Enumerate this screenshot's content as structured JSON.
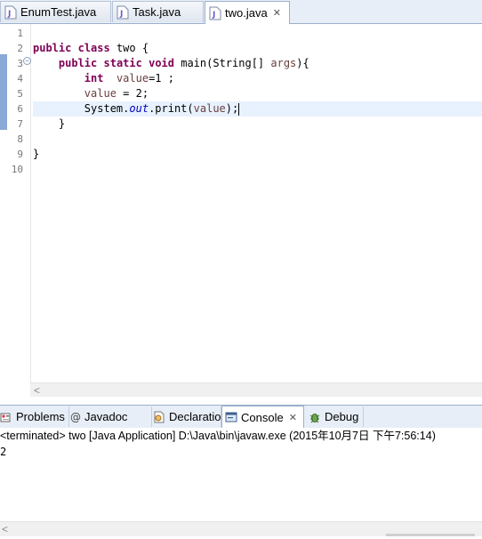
{
  "editor_tabs": [
    {
      "label": "EnumTest.java",
      "active": false
    },
    {
      "label": "Task.java",
      "active": false
    },
    {
      "label": "two.java",
      "active": true,
      "close_icon": "close-icon"
    }
  ],
  "code": {
    "line_numbers": [
      "1",
      "2",
      "3",
      "4",
      "5",
      "6",
      "7",
      "8",
      "9",
      "10"
    ],
    "current_line": 6,
    "lines": [
      [],
      [
        {
          "t": "public",
          "c": "kw"
        },
        {
          "t": " "
        },
        {
          "t": "class",
          "c": "kw"
        },
        {
          "t": " two {"
        }
      ],
      [
        {
          "t": "    "
        },
        {
          "t": "public",
          "c": "kw"
        },
        {
          "t": " "
        },
        {
          "t": "static",
          "c": "kw"
        },
        {
          "t": " "
        },
        {
          "t": "void",
          "c": "kw"
        },
        {
          "t": " main(String[] "
        },
        {
          "t": "args",
          "c": "lv"
        },
        {
          "t": "){"
        }
      ],
      [
        {
          "t": "        "
        },
        {
          "t": "int",
          "c": "kw"
        },
        {
          "t": "  "
        },
        {
          "t": "value",
          "c": "lv"
        },
        {
          "t": "=1 ;"
        }
      ],
      [
        {
          "t": "        "
        },
        {
          "t": "value",
          "c": "lv"
        },
        {
          "t": " = 2;"
        }
      ],
      [
        {
          "t": "        System."
        },
        {
          "t": "out",
          "c": "fld"
        },
        {
          "t": ".print("
        },
        {
          "t": "value",
          "c": "lv"
        },
        {
          "t": ");"
        },
        {
          "caret": true
        }
      ],
      [
        {
          "t": "    }"
        }
      ],
      [],
      [
        {
          "t": "}"
        }
      ],
      []
    ]
  },
  "view_tabs": [
    {
      "label": "Problems",
      "icon": "problems-icon",
      "active": false
    },
    {
      "label": "Javadoc",
      "icon": "at-icon",
      "active": false
    },
    {
      "label": "Declaration",
      "icon": "declaration-icon",
      "active": false
    },
    {
      "label": "Console",
      "icon": "console-icon",
      "active": true,
      "close_icon": "close-icon"
    },
    {
      "label": "Debug",
      "icon": "bug-icon",
      "active": false
    }
  ],
  "console": {
    "status": "<terminated> two [Java Application] D:\\Java\\bin\\javaw.exe (2015年10月7日 下午7:56:14)",
    "output": "2"
  },
  "colors": {
    "keyword": "#7f0055",
    "field": "#0000c0",
    "local_variable": "#6a3e3e",
    "current_line": "#e8f2fe",
    "tab_strip": "#e8eef7"
  }
}
